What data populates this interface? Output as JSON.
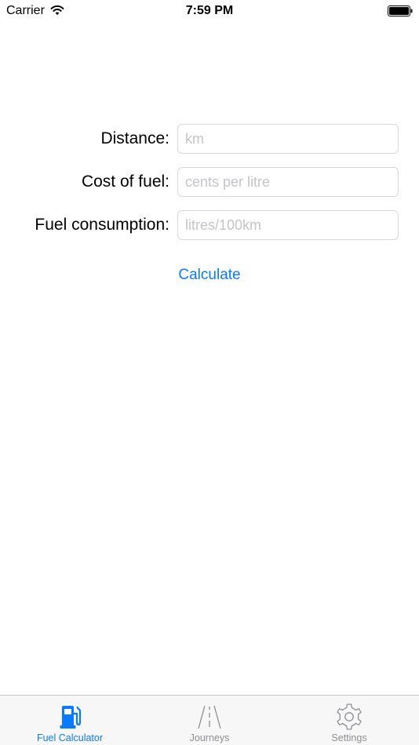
{
  "status_bar": {
    "carrier": "Carrier",
    "time": "7:59 PM",
    "wifi_icon": "wifi-icon",
    "battery_icon": "battery-full-icon"
  },
  "form": {
    "distance": {
      "label": "Distance:",
      "placeholder": "km",
      "value": ""
    },
    "cost_of_fuel": {
      "label": "Cost of fuel:",
      "placeholder": "cents per litre",
      "value": ""
    },
    "fuel_consumption": {
      "label": "Fuel consumption:",
      "placeholder": "litres/100km",
      "value": ""
    },
    "calculate_label": "Calculate"
  },
  "tab_bar": {
    "tabs": [
      {
        "label": "Fuel Calculator",
        "icon": "fuel-pump-icon",
        "selected": true
      },
      {
        "label": "Journeys",
        "icon": "road-icon",
        "selected": false
      },
      {
        "label": "Settings",
        "icon": "gear-icon",
        "selected": false
      }
    ]
  },
  "colors": {
    "accent": "#0a7aff",
    "tab_inactive": "#8e8e93",
    "placeholder": "#c4c4c9",
    "input_border": "#d8d8dc"
  }
}
